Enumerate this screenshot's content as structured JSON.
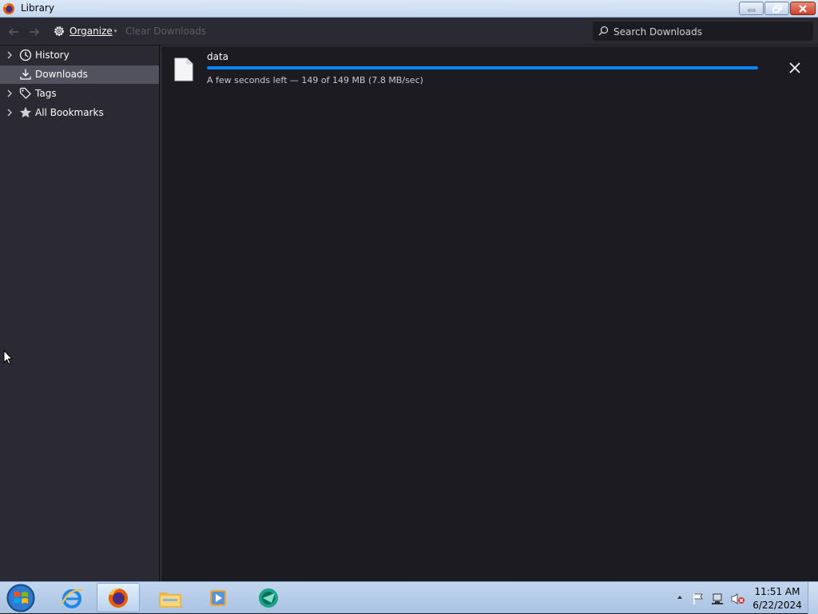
{
  "window": {
    "title": "Library",
    "app_icon": "firefox-icon"
  },
  "toolbar": {
    "back_icon": "back-arrow-icon",
    "forward_icon": "forward-arrow-icon",
    "organize_label": "Organize",
    "clear_label": "Clear Downloads",
    "search_placeholder": "Search Downloads"
  },
  "sidebar": {
    "items": [
      {
        "label": "History",
        "icon": "clock-icon",
        "expandable": true,
        "selected": false
      },
      {
        "label": "Downloads",
        "icon": "download-icon",
        "expandable": false,
        "selected": true
      },
      {
        "label": "Tags",
        "icon": "tag-icon",
        "expandable": true,
        "selected": false
      },
      {
        "label": "All Bookmarks",
        "icon": "star-icon",
        "expandable": true,
        "selected": false
      }
    ]
  },
  "downloads": [
    {
      "name": "data",
      "status": "A few seconds left — 149 of 149 MB (7.8 MB/sec)",
      "progress": 1.0
    }
  ],
  "taskbar": {
    "apps": [
      "internet-explorer-icon",
      "firefox-icon",
      "file-explorer-icon",
      "media-player-icon",
      "app-icon"
    ],
    "active_app": "firefox-icon",
    "clock_time": "11:51 AM",
    "clock_date": "6/22/2024"
  },
  "colors": {
    "accent": "#0a84ff",
    "sidebar_bg": "#2b2a33",
    "main_bg": "#1c1b22",
    "selected_bg": "#52515e"
  }
}
